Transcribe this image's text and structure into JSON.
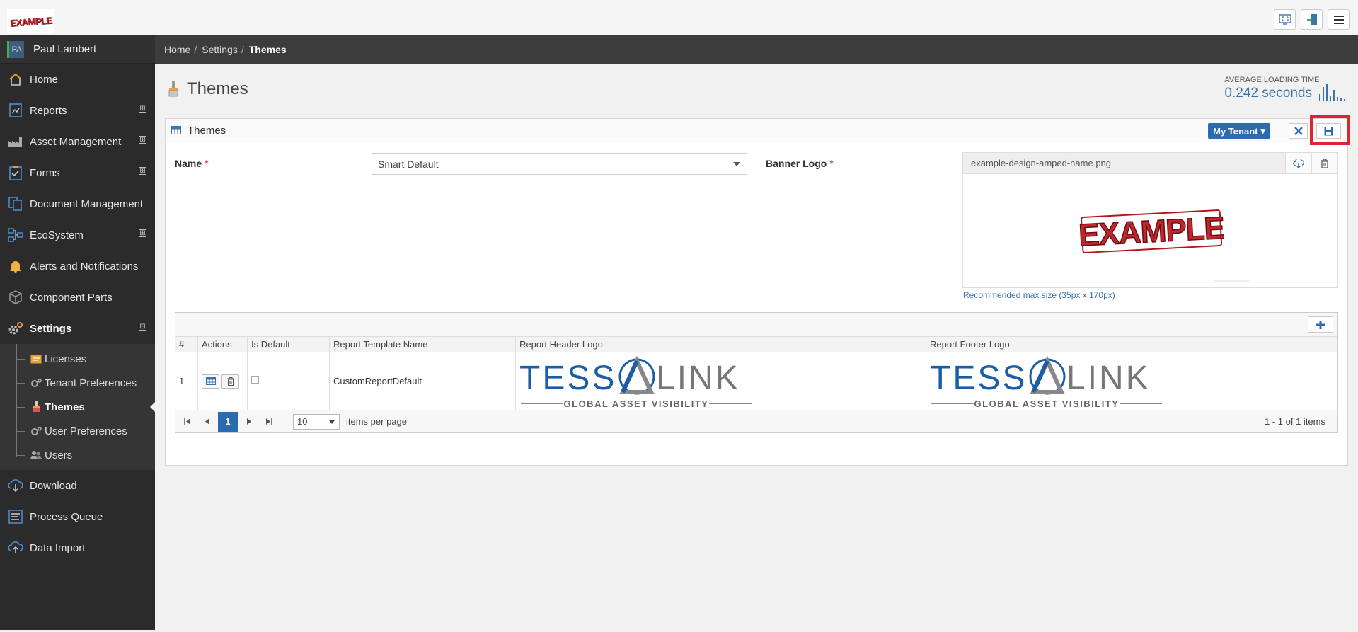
{
  "header": {
    "logo_text": "EXAMPLE"
  },
  "user": {
    "initials": "PA",
    "name": "Paul Lambert"
  },
  "sidebar": {
    "items": [
      {
        "label": "Home",
        "icon": "home-icon",
        "expandable": false
      },
      {
        "label": "Reports",
        "icon": "reports-icon",
        "expandable": true
      },
      {
        "label": "Asset Management",
        "icon": "factory-icon",
        "expandable": true
      },
      {
        "label": "Forms",
        "icon": "clipboard-icon",
        "expandable": true
      },
      {
        "label": "Document Management",
        "icon": "documents-icon",
        "expandable": false
      },
      {
        "label": "EcoSystem",
        "icon": "network-icon",
        "expandable": true
      },
      {
        "label": "Alerts and Notifications",
        "icon": "bell-icon",
        "expandable": false
      },
      {
        "label": "Component Parts",
        "icon": "cube-icon",
        "expandable": false
      },
      {
        "label": "Settings",
        "icon": "gear-icon",
        "expandable": true,
        "expanded": true
      }
    ],
    "settings_sub": [
      {
        "label": "Licenses"
      },
      {
        "label": "Tenant Preferences"
      },
      {
        "label": "Themes"
      },
      {
        "label": "User Preferences"
      },
      {
        "label": "Users"
      }
    ],
    "bottom_items": [
      {
        "label": "Download"
      },
      {
        "label": "Process Queue"
      },
      {
        "label": "Data Import"
      }
    ],
    "expand_symbol": "⊞",
    "collapse_symbol": "⊟"
  },
  "breadcrumb": {
    "home": "Home",
    "settings": "Settings",
    "current": "Themes",
    "separator": "/"
  },
  "page": {
    "title": "Themes"
  },
  "load_time": {
    "label": "AVERAGE LOADING TIME",
    "value": "0.242 seconds"
  },
  "panel": {
    "title": "Themes",
    "tenant_label": "My Tenant",
    "tenant_caret": "▾"
  },
  "form": {
    "name_label": "Name",
    "required_mark": "*",
    "name_value": "Smart Default",
    "banner_label": "Banner Logo",
    "banner_file": "example-design-amped-name.png",
    "banner_preview_text": "EXAMPLE",
    "banner_hint": "Recommended max size (35px x 170px)"
  },
  "grid": {
    "columns": [
      "#",
      "Actions",
      "Is Default",
      "Report Template Name",
      "Report Header Logo",
      "Report Footer Logo"
    ],
    "rows": [
      {
        "num": "1",
        "template_name": "CustomReportDefault",
        "is_default": false
      }
    ],
    "logo_main_left": "TESS",
    "logo_main_right": "LINK",
    "logo_sub": "GLOBAL ASSET VISIBILITY"
  },
  "pager": {
    "current_page": "1",
    "page_size": "10",
    "items_label": "items per page",
    "info": "1 - 1 of 1 items"
  },
  "colors": {
    "brand_blue": "#2b6bb0",
    "highlight_red": "#e0242c",
    "sidebar_bg": "#2b2b2b"
  }
}
